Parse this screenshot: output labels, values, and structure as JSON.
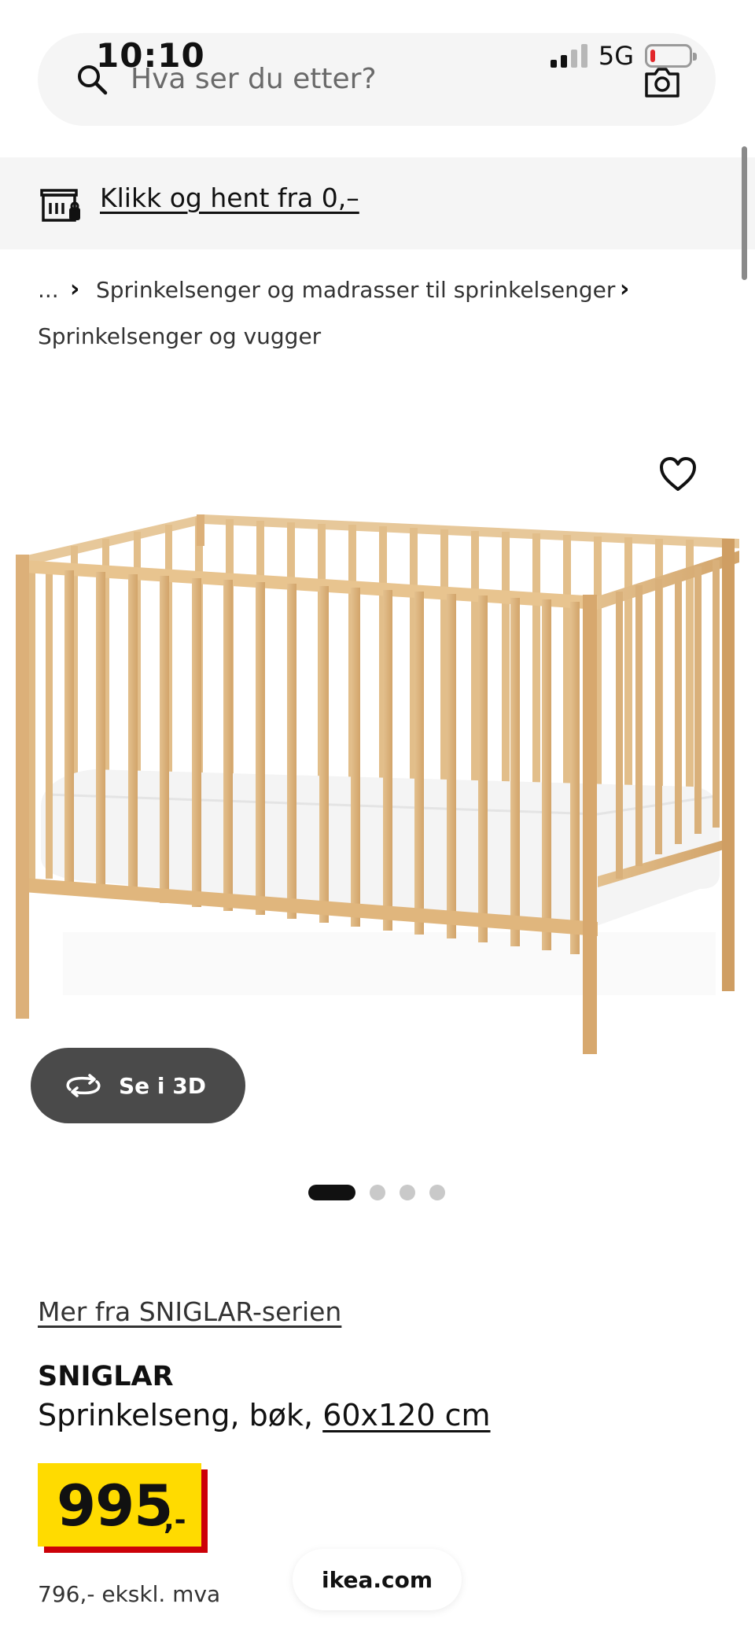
{
  "status_bar": {
    "time": "10:10",
    "network": "5G"
  },
  "search": {
    "placeholder": "Hva ser du etter?"
  },
  "collect": {
    "label": "Klikk og hent fra 0,–"
  },
  "breadcrumb": {
    "ellipsis": "...",
    "items": [
      "Sprinkelsenger og madrasser til sprinkelsenger",
      "Sprinkelsenger og vugger"
    ]
  },
  "gallery": {
    "view3d_label": "Se i 3D",
    "total_images": 4,
    "active_index": 0
  },
  "product": {
    "series_link": "Mer fra SNIGLAR-serien",
    "name": "SNIGLAR",
    "description": "Sprinkelseng, bøk,",
    "size": "60x120 cm",
    "price": "995",
    "price_suffix": ",-",
    "price_ex_vat": "796,- ekskl. mva"
  },
  "browser": {
    "url": "ikea.com"
  },
  "colors": {
    "price_bg": "#ffdb00",
    "price_shadow": "#cc0008",
    "pill_bg": "#f5f5f5",
    "button_3d": "#4a4a4a"
  }
}
